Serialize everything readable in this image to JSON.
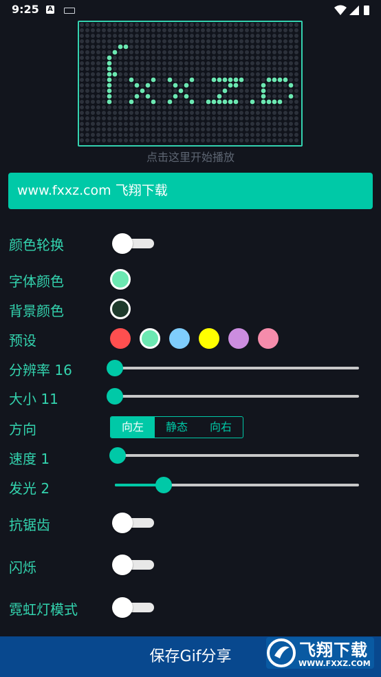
{
  "status_bar": {
    "time": "9:25",
    "notification_letter": "A"
  },
  "led_preview": {
    "display_text": "fxxz.c",
    "dot_color": "#6ce8b2",
    "background_color": "#10131b",
    "border_color": "#34d2b0"
  },
  "play_hint": "点击这里开始播放",
  "text_input": {
    "value": "www.fxxz.com 飞翔下载"
  },
  "settings": {
    "color_cycle": {
      "label": "颜色轮换",
      "on": false
    },
    "font_color": {
      "label": "字体颜色",
      "color": "#6ce8b2"
    },
    "bg_color": {
      "label": "背景颜色",
      "color": "#1e3a2c"
    },
    "presets": {
      "label": "预设",
      "colors": [
        "#ff4f4f",
        "#6ce8b2",
        "#7fcdfc",
        "#ffff00",
        "#cc8ddf",
        "#f58cab"
      ],
      "selected_index": 1
    },
    "resolution": {
      "label": "分辨率 16",
      "fraction": 0.0
    },
    "size": {
      "label": "大小 11",
      "fraction": 0.0
    },
    "direction": {
      "label": "方向",
      "options": [
        "向左",
        "静态",
        "向右"
      ],
      "selected_index": 0
    },
    "speed": {
      "label": "速度 1",
      "fraction": 0.01
    },
    "glow": {
      "label": "发光 2",
      "fraction": 0.2
    },
    "antialias": {
      "label": "抗锯齿",
      "on": false
    },
    "flash": {
      "label": "闪烁",
      "on": false
    },
    "neon_mode": {
      "label": "霓虹灯模式",
      "on": false
    }
  },
  "save_button": {
    "label": "保存Gif分享"
  },
  "watermark": {
    "title": "飞翔下载",
    "url": "WWW.FXXZ.COM"
  },
  "accent_color": "#00c9a7"
}
